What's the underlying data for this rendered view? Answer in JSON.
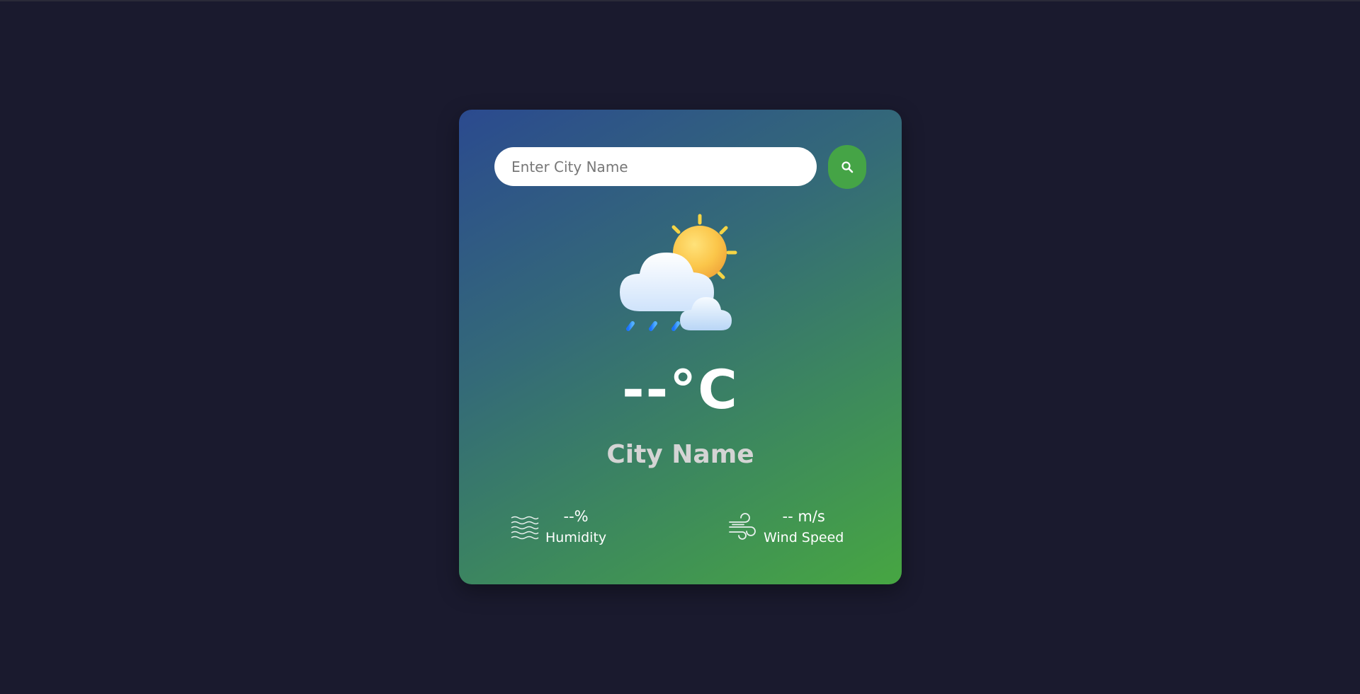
{
  "search": {
    "placeholder": "Enter City Name",
    "value": "",
    "button_icon": "search-icon"
  },
  "weather": {
    "icon": "sun-cloud-rain-icon",
    "temperature": "--°C",
    "city": "City Name"
  },
  "details": {
    "humidity": {
      "icon": "humidity-waves-icon",
      "value": "--%",
      "label": "Humidity"
    },
    "wind": {
      "icon": "wind-icon",
      "value": "-- m/s",
      "label": "Wind Speed"
    }
  },
  "colors": {
    "background": "#1a1a2e",
    "card_gradient_start": "#2b4a8f",
    "card_gradient_end": "#47a642",
    "search_button": "#45a446",
    "temperature_text": "#ffffff",
    "city_text": "#d4d4d4"
  }
}
